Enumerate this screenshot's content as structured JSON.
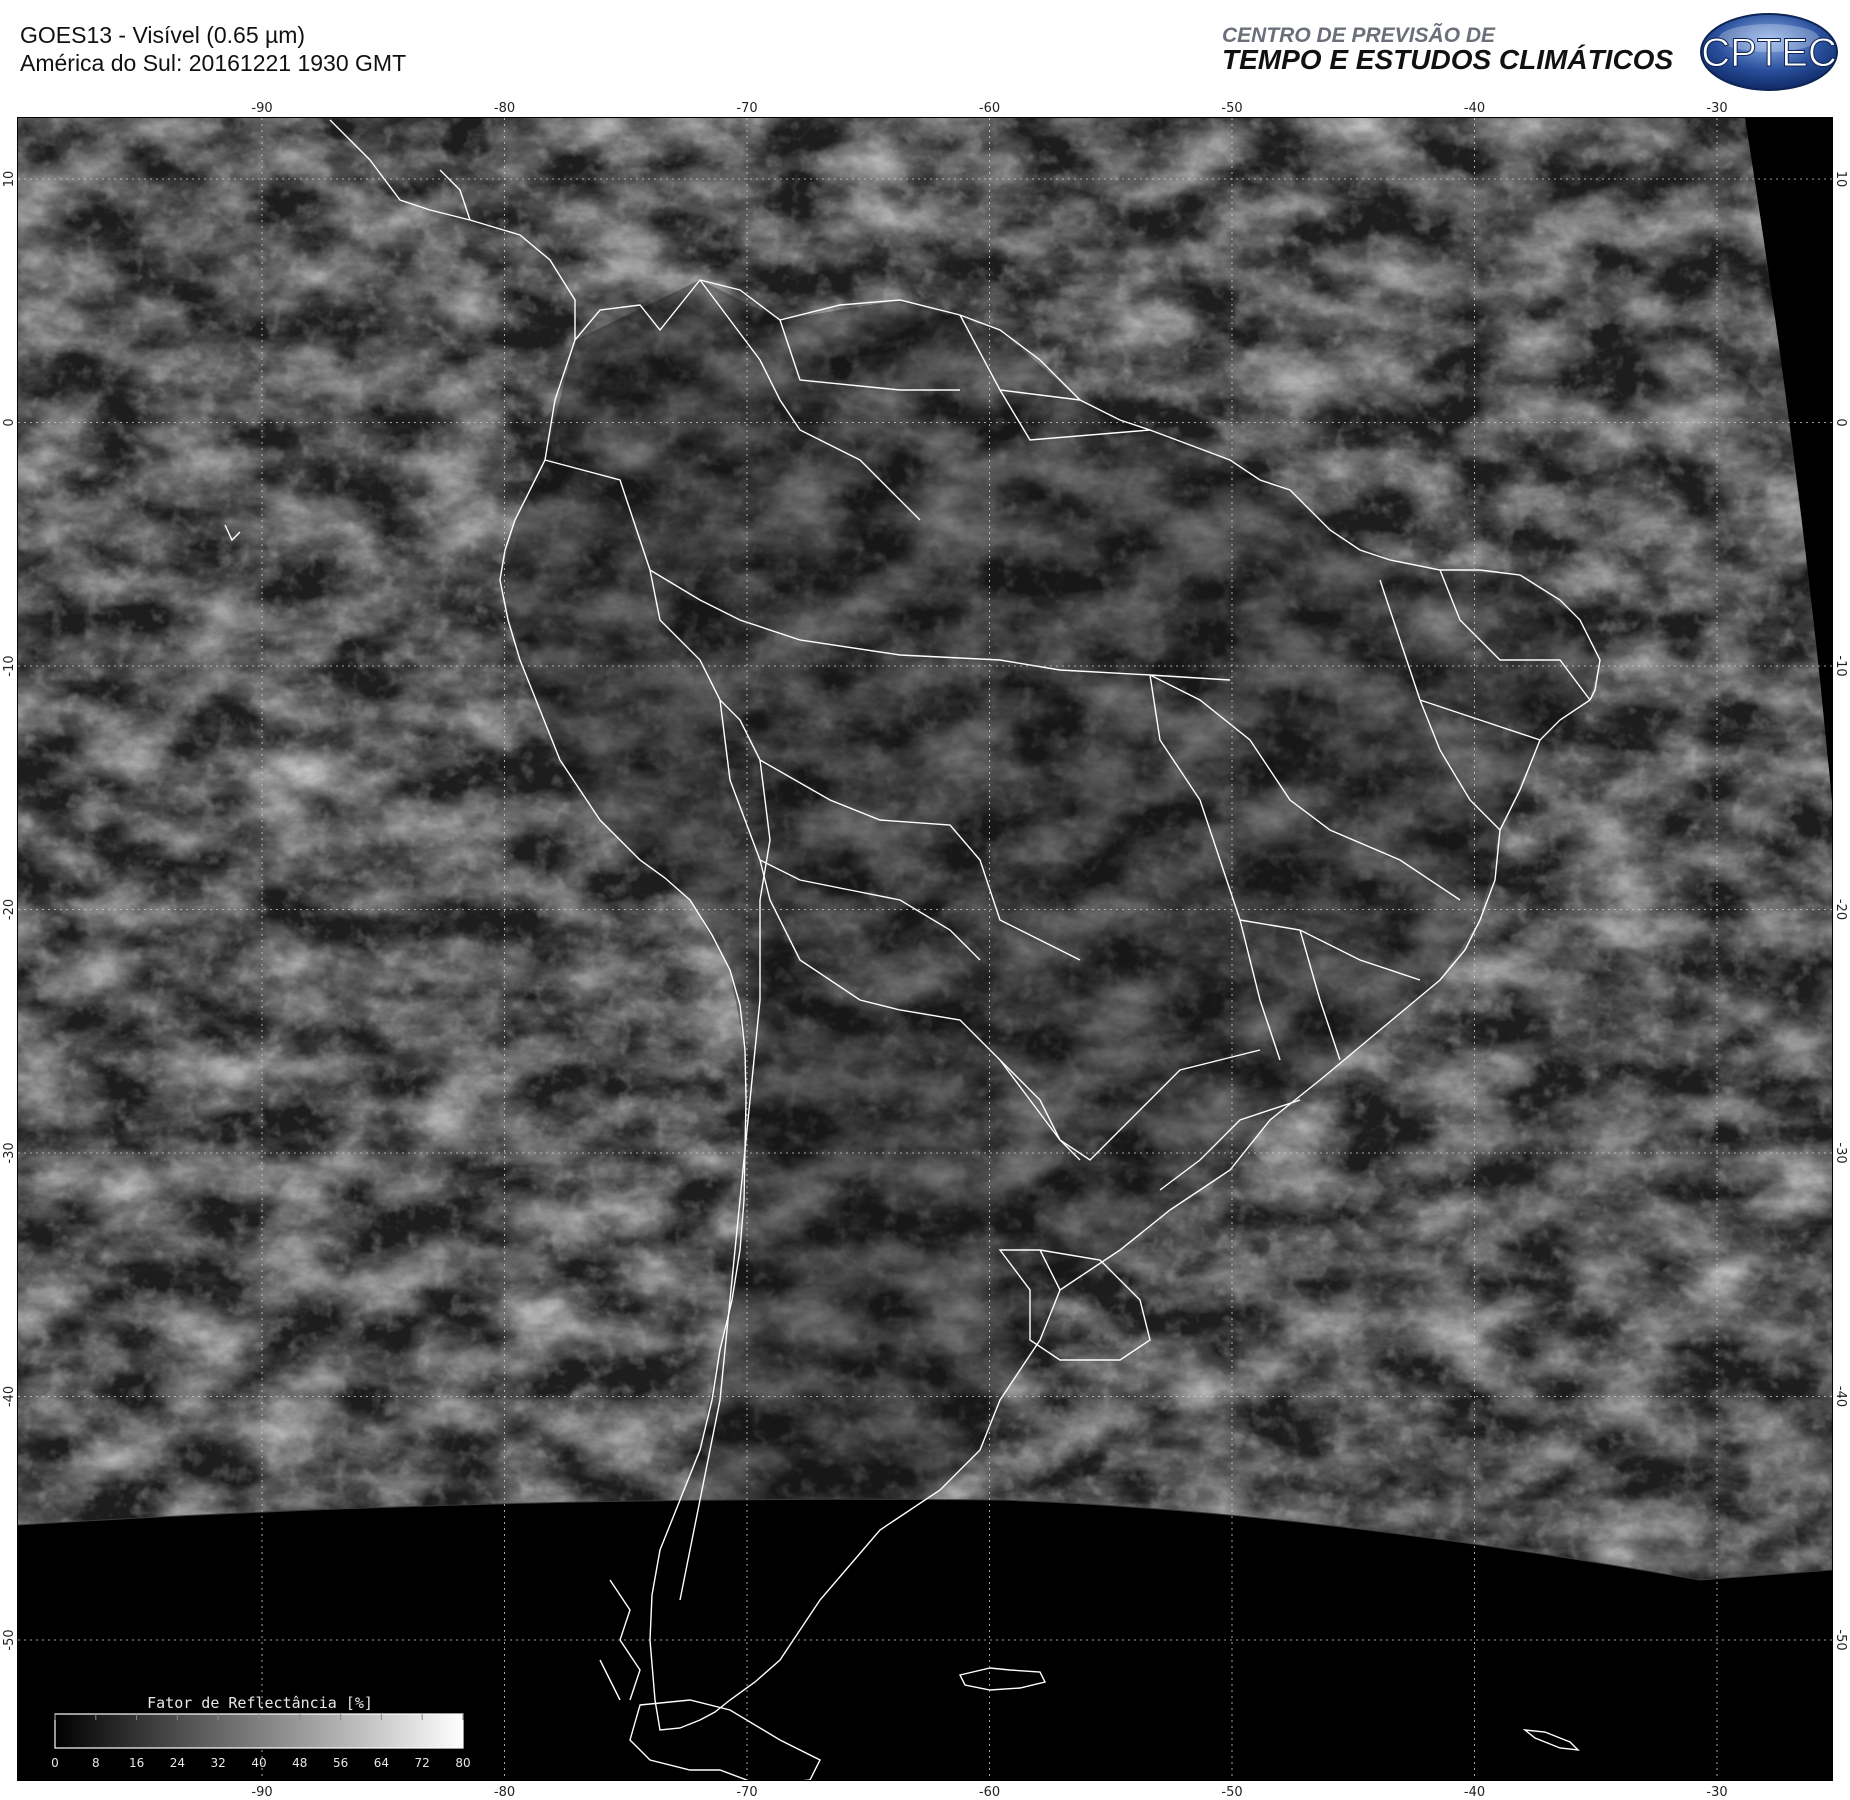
{
  "header": {
    "title_line1": "GOES13 - Visível (0.65 µm)",
    "title_line2": "América do Sul: 20161221 1930 GMT",
    "org_line1": "CENTRO DE PREVISÃO DE",
    "org_line2": "TEMPO E ESTUDOS CLIMÁTICOS",
    "logo_text": "CPTEC"
  },
  "map": {
    "lon_labels": [
      "-90",
      "-80",
      "-70",
      "-60",
      "-50",
      "-40",
      "-30"
    ],
    "lat_labels": [
      "10",
      "0",
      "-10",
      "-20",
      "-30",
      "-40",
      "-50"
    ],
    "lon_values": [
      -90,
      -80,
      -70,
      -60,
      -50,
      -40,
      -30
    ],
    "lat_values": [
      10,
      0,
      -10,
      -20,
      -30,
      -40,
      -50
    ],
    "grid": true
  },
  "colorbar": {
    "title": "Fator de Reflectância [%]",
    "ticks": [
      "0",
      "8",
      "16",
      "24",
      "32",
      "40",
      "48",
      "56",
      "64",
      "72",
      "80"
    ],
    "range": [
      0,
      80
    ]
  },
  "colors": {
    "background": "#ffffff",
    "frame": "#000000",
    "outlines": "#ffffff",
    "logo_blue": "#2a4f9c"
  }
}
